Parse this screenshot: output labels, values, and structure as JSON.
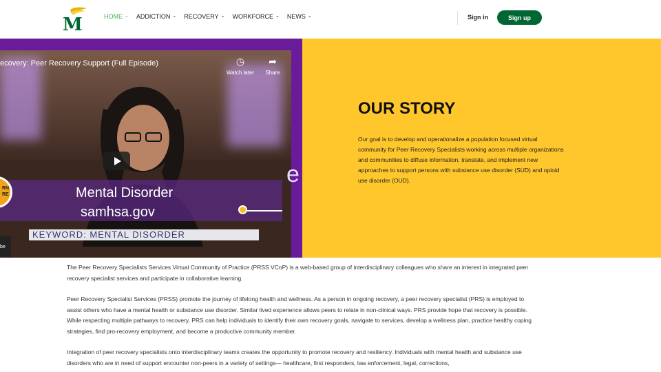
{
  "header": {
    "logo_letter": "M",
    "nav": [
      {
        "label": "HOME",
        "active": true
      },
      {
        "label": "ADDICTION",
        "active": false
      },
      {
        "label": "RECOVERY",
        "active": false
      },
      {
        "label": "WORKFORCE",
        "active": false
      },
      {
        "label": "NEWS",
        "active": false
      }
    ],
    "signin_label": "Sign in",
    "signup_label": "Sign up"
  },
  "video": {
    "title": "ecovery: Peer Recovery Support (Full Episode)",
    "watch_later_label": "Watch later",
    "share_label": "Share",
    "lower_third_title": "Mental Disorder",
    "lower_third_site": "samhsa.gov",
    "keyword": "KEYWORD: MENTAL DISORDER",
    "badge_text": "RN RE",
    "youtube_tag": "be",
    "side_letter": "e"
  },
  "story": {
    "title": "OUR STORY",
    "body": "Our goal is to develop and operationalize a population focused virtual community for Peer Recovery Specialists working across multiple organizations and communities to diffuse information, translate, and implement new approaches to support persons with substance use disorder (SUD) and opioid use disorder (OUD)."
  },
  "content": {
    "p1": "The Peer Recovery Specialists Services Virtual Community of Practice (PRSS VCoP) is a web-based group of interdisciplinary colleagues who share an interest in integrated peer recovery specialist services and participate in collaborative learning.",
    "p2": "Peer Recovery Specialist Services (PRSS) promote the journey of lifelong health and wellness. As a person in ongoing recovery, a peer recovery specialist (PRS) is employed to assist others who have a mental health or substance use disorder. Similar lived experience allows peers to relate in non-clinical ways. PRS provide hope that recovery is possible. While respecting multiple pathways to recovery, PRS can help individuals to identify their own recovery goals, navigate to services, develop a wellness plan, practice healthy coping strategies, find pro-recovery employment, and become a productive community member.",
    "p3": "Integration of peer recovery specialists onto interdisciplinary teams creates the opportunity to promote recovery and resiliency. Individuals with mental health and substance use disorders who are in need of support encounter non-peers in a variety of settings— healthcare, first responders, law enforcement, legal, corrections,"
  },
  "colors": {
    "brand_green": "#006633",
    "active_nav": "#4caf50",
    "hero_yellow": "#ffc72c",
    "hero_purple": "#6a1b9a"
  }
}
